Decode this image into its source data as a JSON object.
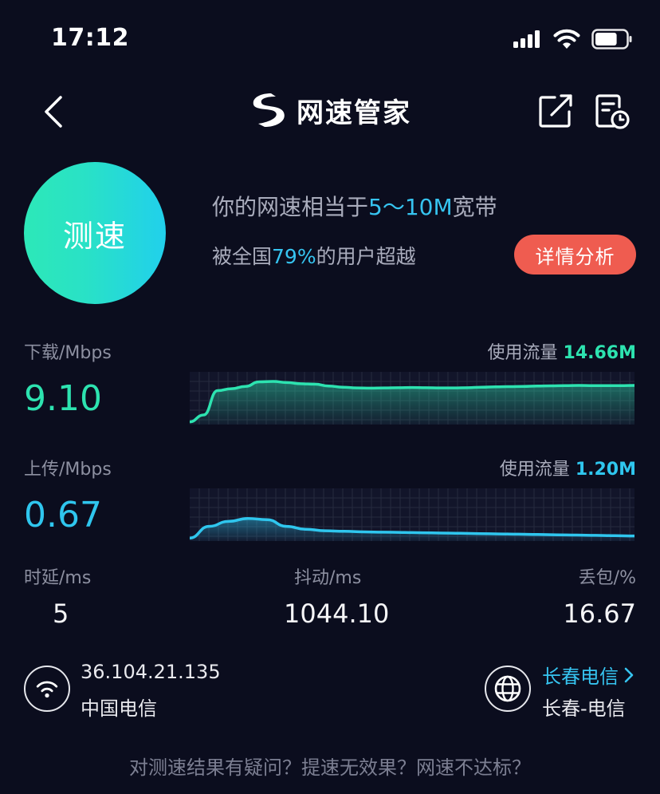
{
  "status_bar": {
    "time": "17:12",
    "icons": [
      "signal-icon",
      "wifi-icon",
      "battery-icon"
    ],
    "battery_level_fraction": 0.72
  },
  "nav": {
    "title": "网速管家",
    "icons": [
      "back-icon",
      "app-logo-icon",
      "share-icon",
      "history-icon"
    ]
  },
  "test_button": {
    "label": "测速"
  },
  "result": {
    "equiv_prefix": "你的网速相当于",
    "equiv_value": "5～10M",
    "equiv_suffix": "宽带",
    "beat_prefix": "被全国",
    "beat_value": "79%",
    "beat_suffix": "的用户超越",
    "detail_button": "详情分析"
  },
  "download": {
    "label": "下载",
    "unit": "/Mbps",
    "value": "9.10",
    "usage_label": "使用流量",
    "usage_value": "14.66M",
    "color": "#2de3b0"
  },
  "upload": {
    "label": "上传",
    "unit": "/Mbps",
    "value": "0.67",
    "usage_label": "使用流量",
    "usage_value": "1.20M",
    "color": "#2fc6ee"
  },
  "chart_data": [
    {
      "type": "area",
      "name": "download",
      "values": [
        0.3,
        2.1,
        8.5,
        9.0,
        9.6,
        10.8,
        10.9,
        10.6,
        10.3,
        10.2,
        9.7,
        9.4,
        9.2,
        9.15,
        9.2,
        9.25,
        9.3,
        9.25,
        9.2,
        9.2,
        9.25,
        9.4,
        9.5,
        9.55,
        9.6,
        9.7,
        9.75,
        9.8,
        9.85,
        9.8,
        9.8,
        9.8,
        9.85
      ],
      "ylim": [
        0,
        13
      ],
      "grid": true
    },
    {
      "type": "area",
      "name": "upload",
      "values": [
        0.05,
        0.45,
        0.62,
        0.72,
        0.68,
        0.45,
        0.35,
        0.3,
        0.28,
        0.26,
        0.25,
        0.24,
        0.23,
        0.22,
        0.21,
        0.2,
        0.19,
        0.18,
        0.17,
        0.16,
        0.15,
        0.14,
        0.13,
        0.12
      ],
      "ylim": [
        0,
        1.7
      ],
      "grid": true
    }
  ],
  "stats": {
    "latency_label": "时延",
    "latency_unit": "/ms",
    "latency_value": "5",
    "jitter_label": "抖动",
    "jitter_unit": "/ms",
    "jitter_value": "1044.10",
    "loss_label": "丢包",
    "loss_unit": "/%",
    "loss_value": "16.67"
  },
  "network": {
    "ip": "36.104.21.135",
    "isp": "中国电信",
    "server_link": "长春电信",
    "server_name": "长春-电信",
    "icons": [
      "wifi-circle-icon",
      "globe-icon",
      "chevron-right-icon"
    ]
  },
  "footer": {
    "text": "对测速结果有疑问？提速无效果？网速不达标？"
  },
  "colors": {
    "background": "#0b0d1e",
    "download_accent": "#2de3b0",
    "upload_accent": "#2fc6ee",
    "highlight": "#36c4f0",
    "detail_button": "#ef5c50"
  }
}
